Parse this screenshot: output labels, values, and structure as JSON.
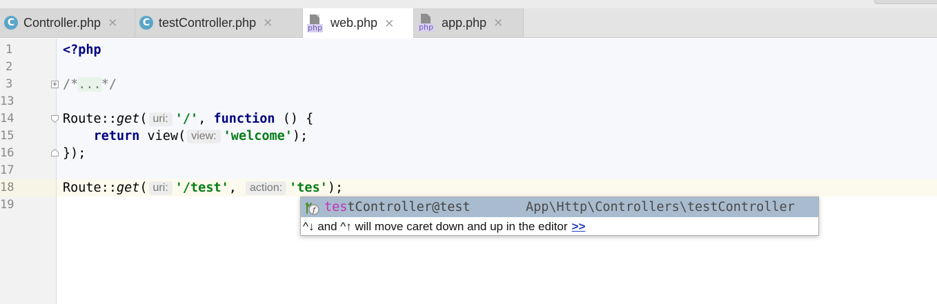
{
  "tabs": [
    {
      "label": "Controller.php",
      "icon": "class-icon",
      "icon_glyph": "C",
      "active": false
    },
    {
      "label": "testController.php",
      "icon": "class-icon",
      "icon_glyph": "C",
      "active": false
    },
    {
      "label": "web.php",
      "icon": "php-file-icon",
      "icon_glyph": "php",
      "active": true
    },
    {
      "label": "app.php",
      "icon": "php-file-icon",
      "icon_glyph": "php",
      "active": false
    }
  ],
  "close_glyph": "×",
  "lines": {
    "n1": "1",
    "n2": "2",
    "n3": "3",
    "n13": "13",
    "n14": "14",
    "n15": "15",
    "n16": "16",
    "n17": "17",
    "n18": "18",
    "n19": "19"
  },
  "code": {
    "open_tag": "<?php",
    "folded_comment_start": "/*",
    "folded_comment_dots": "...",
    "folded_comment_end": "*/",
    "route_class": "Route::",
    "get_method": "get",
    "paren_open": "(",
    "hint_uri": "uri:",
    "root_path": "'/'",
    "comma": ", ",
    "function_kw": "function",
    "closure_sig": " () {",
    "indent": "    ",
    "return_kw": "return",
    "view_call": " view(",
    "hint_view": "view:",
    "welcome_str": "'welcome'",
    "close_call": ");",
    "close_closure": "});",
    "test_path": "'/test'",
    "comma2": ",",
    "hint_action": "action:",
    "typed_str": "'tes'",
    "end_stmt": ");"
  },
  "completion": {
    "item_match": "tes",
    "item_rest": "tController@test",
    "item_path": "App\\Http\\Controllers\\testController",
    "tip": "^↓ and ^↑ will move caret down and up in the editor",
    "tip_link": ">>"
  },
  "colors": {
    "keyword": "#000080",
    "string": "#067d17",
    "match_highlight": "#c033b8",
    "selection": "#a9bccf"
  }
}
